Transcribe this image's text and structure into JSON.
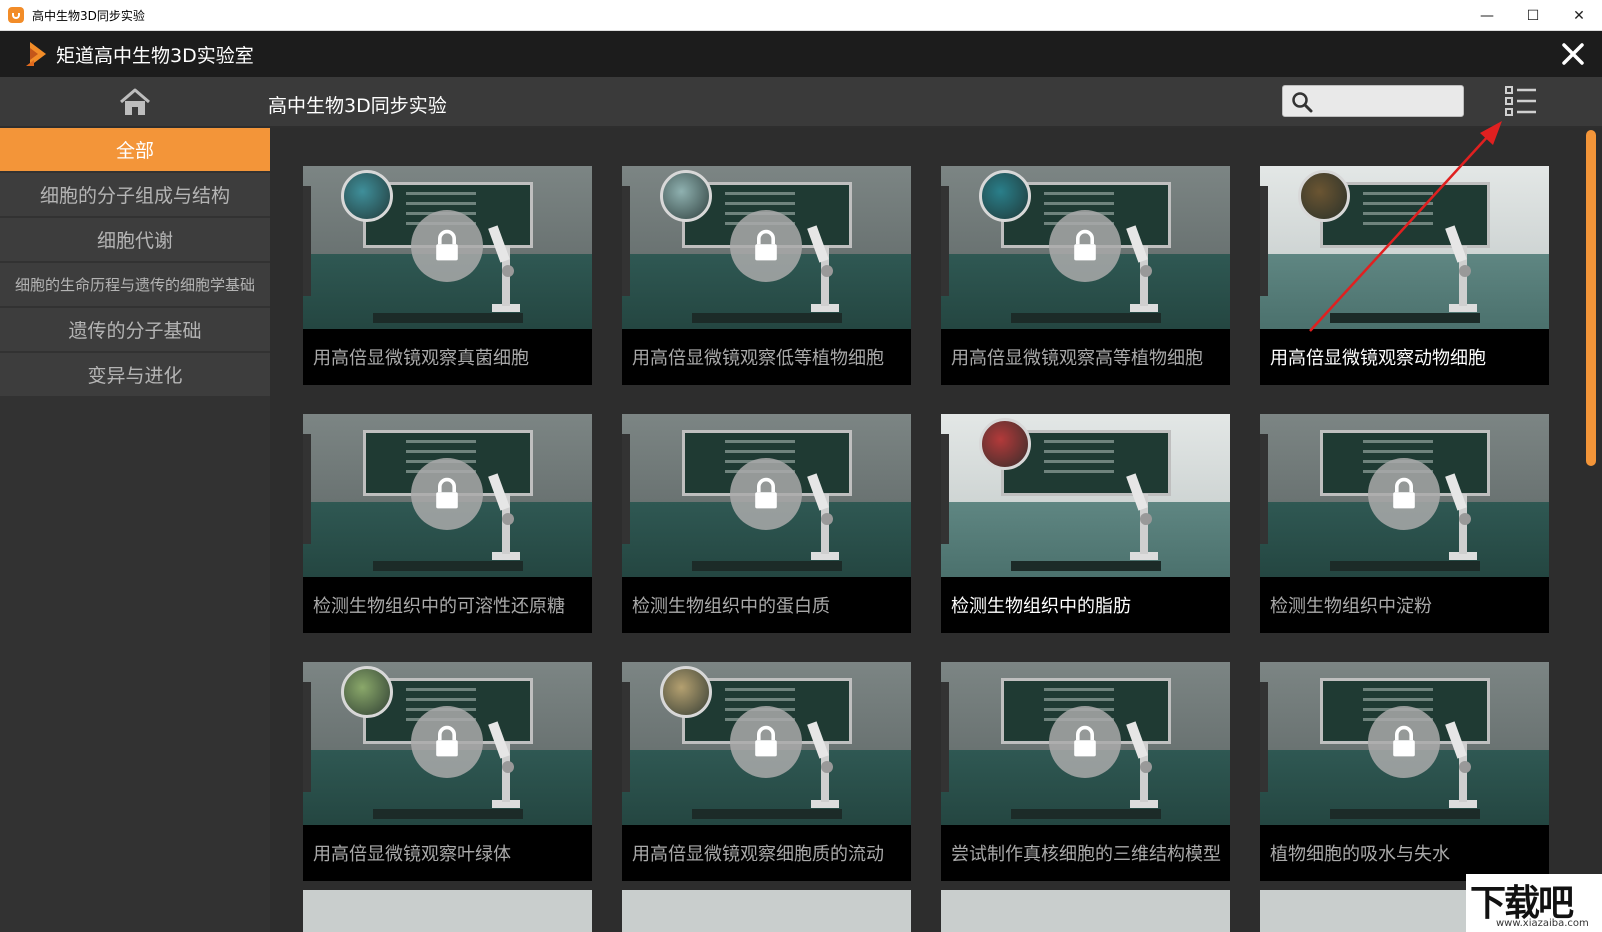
{
  "window": {
    "title": "高中生物3D同步实验",
    "controls": {
      "minimize": "—",
      "maximize": "☐",
      "close": "✕"
    }
  },
  "app": {
    "title": "矩道高中生物3D实验室"
  },
  "navbar": {
    "page_title": "高中生物3D同步实验",
    "search_placeholder": "",
    "icons": {
      "home": "home-icon",
      "search": "search-icon",
      "list_view": "list-view-icon"
    }
  },
  "sidebar": {
    "items": [
      {
        "label": "全部",
        "active": true
      },
      {
        "label": "细胞的分子组成与结构",
        "active": false
      },
      {
        "label": "细胞代谢",
        "active": false
      },
      {
        "label": "细胞的生命历程与遗传的细胞学基础",
        "active": false
      },
      {
        "label": "遗传的分子基础",
        "active": false
      },
      {
        "label": "变异与进化",
        "active": false
      }
    ]
  },
  "experiments": [
    {
      "title": "用高倍显微镜观察真菌细胞",
      "locked": true,
      "sample_color": "#3f8f9a"
    },
    {
      "title": "用高倍显微镜观察低等植物细胞",
      "locked": true,
      "sample_color": "#8fb1b0"
    },
    {
      "title": "用高倍显微镜观察高等植物细胞",
      "locked": true,
      "sample_color": "#2a7f8a"
    },
    {
      "title": "用高倍显微镜观察动物细胞",
      "locked": false,
      "sample_color": "#6b5532"
    },
    {
      "title": "检测生物组织中的可溶性还原糖",
      "locked": true,
      "sample_color": ""
    },
    {
      "title": "检测生物组织中的蛋白质",
      "locked": true,
      "sample_color": ""
    },
    {
      "title": "检测生物组织中的脂肪",
      "locked": false,
      "sample_color": "#b33a3a"
    },
    {
      "title": "检测生物组织中淀粉",
      "locked": true,
      "sample_color": ""
    },
    {
      "title": "用高倍显微镜观察叶绿体",
      "locked": true,
      "sample_color": "#8aa86a"
    },
    {
      "title": "用高倍显微镜观察细胞质的流动",
      "locked": true,
      "sample_color": "#b4a070"
    },
    {
      "title": "尝试制作真核细胞的三维结构模型",
      "locked": true,
      "sample_color": ""
    },
    {
      "title": "植物细胞的吸水与失水",
      "locked": true,
      "sample_color": ""
    }
  ],
  "watermark": {
    "text": "下载吧",
    "url": "www.xiazaiba.com"
  },
  "colors": {
    "accent": "#f39539",
    "header_bg": "#1c1c1c",
    "navbar_bg": "#3a3a3a",
    "sidebar_item_bg": "#3d3d3d",
    "annotation_arrow": "#e02020"
  }
}
